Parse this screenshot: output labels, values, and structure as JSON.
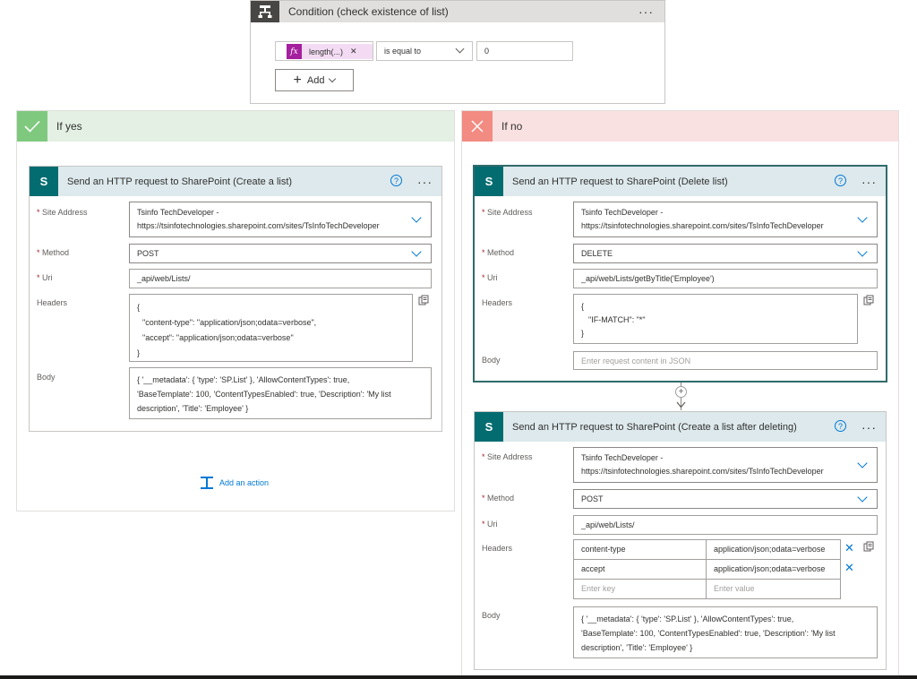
{
  "condition": {
    "title": "Condition (check existence of list)",
    "expression_chip": "length(...)",
    "fx_label": "fx",
    "operator": "is equal to",
    "value": "0",
    "add_label": "Add"
  },
  "branch_yes": {
    "label": "If yes",
    "header_color": "#e3f0e3",
    "icon_color": "#7fc97f"
  },
  "branch_no": {
    "label": "If no",
    "header_color": "#f9e1e1",
    "icon_color": "#f28b82"
  },
  "card_create": {
    "title": "Send an HTTP request to SharePoint (Create a list)",
    "site_address_label": "Site Address",
    "site_line1": "Tsinfo TechDeveloper -",
    "site_line2": "https://tsinfotechnologies.sharepoint.com/sites/TsInfoTechDeveloper",
    "method_label": "Method",
    "method": "POST",
    "uri_label": "Uri",
    "uri": "_api/web/Lists/",
    "headers_label": "Headers",
    "headers_lines": [
      "{",
      "\"content-type\": \"application/json;odata=verbose\",",
      "\"accept\": \"application/json;odata=verbose\"",
      "}"
    ],
    "body_label": "Body",
    "body_lines": [
      "{ '__metadata': { 'type': 'SP.List' }, 'AllowContentTypes': true,",
      "'BaseTemplate': 100, 'ContentTypesEnabled': true, 'Description': 'My list",
      "description', 'Title': 'Employee' }"
    ]
  },
  "add_action_label": "Add an action",
  "card_delete": {
    "title": "Send an HTTP request to SharePoint (Delete list)",
    "site_address_label": "Site Address",
    "site_line1": "Tsinfo TechDeveloper -",
    "site_line2": "https://tsinfotechnologies.sharepoint.com/sites/TsInfoTechDeveloper",
    "method_label": "Method",
    "method": "DELETE",
    "uri_label": "Uri",
    "uri": "_api/web/Lists/getByTitle('Employee')",
    "headers_label": "Headers",
    "headers_lines": [
      "{",
      "\"IF-MATCH\": \"*\"",
      "}"
    ],
    "body_label": "Body",
    "body_placeholder": "Enter request content in JSON"
  },
  "card_create2": {
    "title": "Send an HTTP request to SharePoint (Create a list after deleting)",
    "site_address_label": "Site Address",
    "site_line1": "Tsinfo TechDeveloper -",
    "site_line2": "https://tsinfotechnologies.sharepoint.com/sites/TsInfoTechDeveloper",
    "method_label": "Method",
    "method": "POST",
    "uri_label": "Uri",
    "uri": "_api/web/Lists/",
    "headers_label": "Headers",
    "header_rows": [
      {
        "key": "content-type",
        "value": "application/json;odata=verbose"
      },
      {
        "key": "accept",
        "value": "application/json;odata=verbose"
      }
    ],
    "key_placeholder": "Enter key",
    "value_placeholder": "Enter value",
    "body_label": "Body",
    "body_lines": [
      "{ '__metadata': { 'type': 'SP.List' }, 'AllowContentTypes': true,",
      "'BaseTemplate': 100, 'ContentTypesEnabled': true, 'Description': 'My list",
      "description', 'Title': 'Employee' }"
    ]
  },
  "required_mark": "*",
  "menu_dots": "···",
  "help_glyph": "?",
  "sp_glyph": "S"
}
